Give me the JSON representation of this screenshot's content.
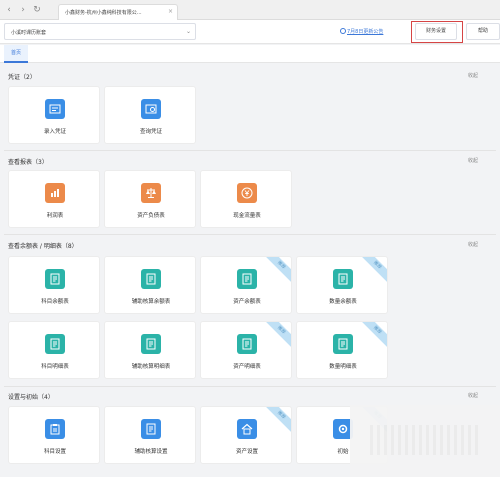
{
  "browser": {
    "tab_title": "小鑫财务-杭州小鑫纯科技有限公..."
  },
  "header": {
    "company": "小溪时课历账套",
    "announcement": "7月8日更新公告",
    "settings_button": "财务设置",
    "help_button": "帮助"
  },
  "tabs": {
    "home": "首页"
  },
  "collapse_label": "收起",
  "ribbon_label": "推荐",
  "sections": [
    {
      "title": "凭证（2）",
      "cards": [
        "录入凭证",
        "查询凭证"
      ]
    },
    {
      "title": "查看报表（3）",
      "cards": [
        "利润表",
        "资产负债表",
        "现金流量表"
      ]
    },
    {
      "title": "查看余额表 / 明细表（8）",
      "cards": [
        "科目余额表",
        "辅助核算余额表",
        "资产余额表",
        "数量余额表",
        "科目明细表",
        "辅助核算明细表",
        "资产明细表",
        "数量明细表"
      ]
    },
    {
      "title": "设置与初始（4）",
      "cards": [
        "科目设置",
        "辅助核算设置",
        "资产设置",
        "初始"
      ]
    }
  ],
  "colors": {
    "accent": "#3c78d8",
    "icon_blue": "#3a8ee6",
    "icon_orange": "#ec8a4a",
    "icon_teal": "#2bb3a8",
    "highlight_red": "#d64545"
  }
}
